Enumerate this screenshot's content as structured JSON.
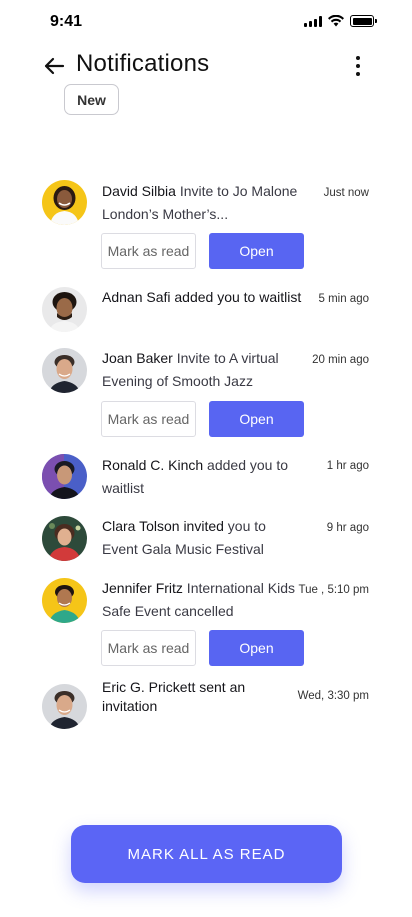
{
  "status_bar": {
    "time": "9:41"
  },
  "header": {
    "title": "Notifications",
    "filter_label": "New"
  },
  "notifications": [
    {
      "name": "David Silbia",
      "text": " Invite to Jo Malone London’s Mother’s...",
      "time": "Just now",
      "actions": true
    },
    {
      "name": "Adnan Safi added you to waitlist",
      "text": "",
      "time": "5 min ago",
      "actions": false
    },
    {
      "name": "Joan Baker",
      "text": "  Invite to A virtual Evening of Smooth Jazz",
      "time": "20 min ago",
      "actions": true
    },
    {
      "name": "Ronald C. Kinch",
      "text": " added you to waitlist",
      "time": "1 hr ago",
      "actions": false
    },
    {
      "name": "Clara Tolson invited",
      "text": " you to Event Gala Music Festival",
      "time": "9 hr ago",
      "actions": false
    },
    {
      "name": "Jennifer Fritz",
      "text": " International Kids Safe Event cancelled",
      "time": "Tue , 5:10 pm",
      "actions": true
    },
    {
      "name": "Eric G. Prickett sent an invitation",
      "text": "",
      "time": "Wed, 3:30 pm",
      "actions": false
    }
  ],
  "buttons": {
    "mark_as_read": "Mark as read",
    "open": "Open",
    "mark_all": "MARK ALL AS READ"
  },
  "colors": {
    "accent": "#5865F2",
    "avatar_yellow": "#F5C518"
  },
  "icons": [
    "back-arrow-icon",
    "more-vertical-icon",
    "signal-icon",
    "wifi-icon",
    "battery-icon"
  ]
}
